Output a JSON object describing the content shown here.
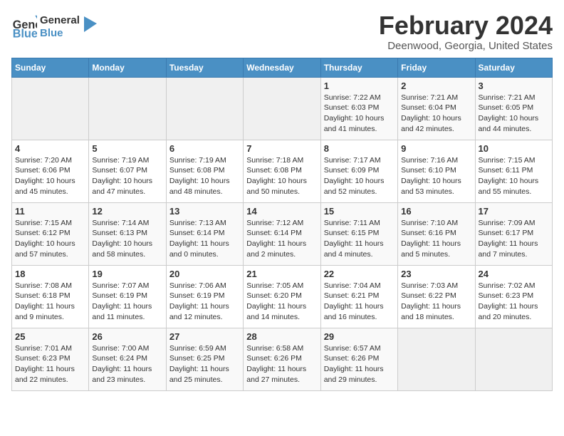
{
  "logo": {
    "line1": "General",
    "line2": "Blue"
  },
  "title": "February 2024",
  "subtitle": "Deenwood, Georgia, United States",
  "headers": [
    "Sunday",
    "Monday",
    "Tuesday",
    "Wednesday",
    "Thursday",
    "Friday",
    "Saturday"
  ],
  "weeks": [
    [
      {
        "day": "",
        "info": ""
      },
      {
        "day": "",
        "info": ""
      },
      {
        "day": "",
        "info": ""
      },
      {
        "day": "",
        "info": ""
      },
      {
        "day": "1",
        "info": "Sunrise: 7:22 AM\nSunset: 6:03 PM\nDaylight: 10 hours\nand 41 minutes."
      },
      {
        "day": "2",
        "info": "Sunrise: 7:21 AM\nSunset: 6:04 PM\nDaylight: 10 hours\nand 42 minutes."
      },
      {
        "day": "3",
        "info": "Sunrise: 7:21 AM\nSunset: 6:05 PM\nDaylight: 10 hours\nand 44 minutes."
      }
    ],
    [
      {
        "day": "4",
        "info": "Sunrise: 7:20 AM\nSunset: 6:06 PM\nDaylight: 10 hours\nand 45 minutes."
      },
      {
        "day": "5",
        "info": "Sunrise: 7:19 AM\nSunset: 6:07 PM\nDaylight: 10 hours\nand 47 minutes."
      },
      {
        "day": "6",
        "info": "Sunrise: 7:19 AM\nSunset: 6:08 PM\nDaylight: 10 hours\nand 48 minutes."
      },
      {
        "day": "7",
        "info": "Sunrise: 7:18 AM\nSunset: 6:08 PM\nDaylight: 10 hours\nand 50 minutes."
      },
      {
        "day": "8",
        "info": "Sunrise: 7:17 AM\nSunset: 6:09 PM\nDaylight: 10 hours\nand 52 minutes."
      },
      {
        "day": "9",
        "info": "Sunrise: 7:16 AM\nSunset: 6:10 PM\nDaylight: 10 hours\nand 53 minutes."
      },
      {
        "day": "10",
        "info": "Sunrise: 7:15 AM\nSunset: 6:11 PM\nDaylight: 10 hours\nand 55 minutes."
      }
    ],
    [
      {
        "day": "11",
        "info": "Sunrise: 7:15 AM\nSunset: 6:12 PM\nDaylight: 10 hours\nand 57 minutes."
      },
      {
        "day": "12",
        "info": "Sunrise: 7:14 AM\nSunset: 6:13 PM\nDaylight: 10 hours\nand 58 minutes."
      },
      {
        "day": "13",
        "info": "Sunrise: 7:13 AM\nSunset: 6:14 PM\nDaylight: 11 hours\nand 0 minutes."
      },
      {
        "day": "14",
        "info": "Sunrise: 7:12 AM\nSunset: 6:14 PM\nDaylight: 11 hours\nand 2 minutes."
      },
      {
        "day": "15",
        "info": "Sunrise: 7:11 AM\nSunset: 6:15 PM\nDaylight: 11 hours\nand 4 minutes."
      },
      {
        "day": "16",
        "info": "Sunrise: 7:10 AM\nSunset: 6:16 PM\nDaylight: 11 hours\nand 5 minutes."
      },
      {
        "day": "17",
        "info": "Sunrise: 7:09 AM\nSunset: 6:17 PM\nDaylight: 11 hours\nand 7 minutes."
      }
    ],
    [
      {
        "day": "18",
        "info": "Sunrise: 7:08 AM\nSunset: 6:18 PM\nDaylight: 11 hours\nand 9 minutes."
      },
      {
        "day": "19",
        "info": "Sunrise: 7:07 AM\nSunset: 6:19 PM\nDaylight: 11 hours\nand 11 minutes."
      },
      {
        "day": "20",
        "info": "Sunrise: 7:06 AM\nSunset: 6:19 PM\nDaylight: 11 hours\nand 12 minutes."
      },
      {
        "day": "21",
        "info": "Sunrise: 7:05 AM\nSunset: 6:20 PM\nDaylight: 11 hours\nand 14 minutes."
      },
      {
        "day": "22",
        "info": "Sunrise: 7:04 AM\nSunset: 6:21 PM\nDaylight: 11 hours\nand 16 minutes."
      },
      {
        "day": "23",
        "info": "Sunrise: 7:03 AM\nSunset: 6:22 PM\nDaylight: 11 hours\nand 18 minutes."
      },
      {
        "day": "24",
        "info": "Sunrise: 7:02 AM\nSunset: 6:23 PM\nDaylight: 11 hours\nand 20 minutes."
      }
    ],
    [
      {
        "day": "25",
        "info": "Sunrise: 7:01 AM\nSunset: 6:23 PM\nDaylight: 11 hours\nand 22 minutes."
      },
      {
        "day": "26",
        "info": "Sunrise: 7:00 AM\nSunset: 6:24 PM\nDaylight: 11 hours\nand 23 minutes."
      },
      {
        "day": "27",
        "info": "Sunrise: 6:59 AM\nSunset: 6:25 PM\nDaylight: 11 hours\nand 25 minutes."
      },
      {
        "day": "28",
        "info": "Sunrise: 6:58 AM\nSunset: 6:26 PM\nDaylight: 11 hours\nand 27 minutes."
      },
      {
        "day": "29",
        "info": "Sunrise: 6:57 AM\nSunset: 6:26 PM\nDaylight: 11 hours\nand 29 minutes."
      },
      {
        "day": "",
        "info": ""
      },
      {
        "day": "",
        "info": ""
      }
    ]
  ]
}
